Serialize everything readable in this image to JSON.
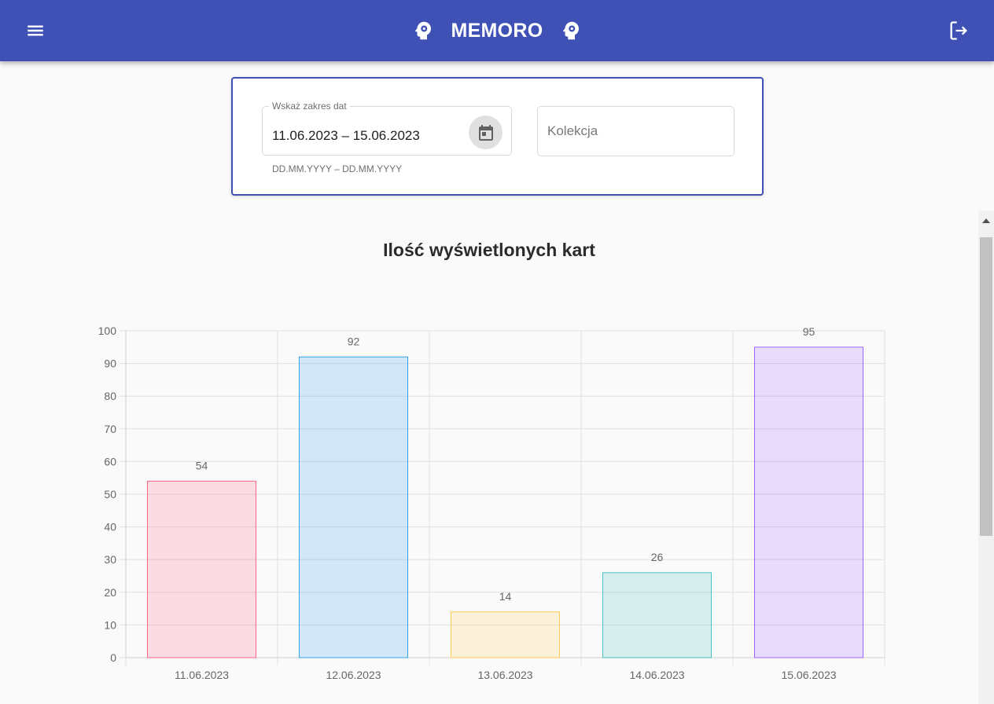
{
  "header": {
    "title": "MEMORO",
    "menu_icon": "hamburger-menu-icon",
    "logout_icon": "logout-icon",
    "brand_icon": "head-gear-icon",
    "bar_color": "#3f51b5"
  },
  "filters": {
    "date_range_label": "Wskaż zakres dat",
    "date_range_value": "11.06.2023 – 15.06.2023",
    "date_range_hint": "DD.MM.YYYY – DD.MM.YYYY",
    "calendar_icon": "calendar-icon",
    "collection_placeholder": "Kolekcja"
  },
  "chart_data": {
    "type": "bar",
    "title": "Ilość wyświetlonych kart",
    "categories": [
      "11.06.2023",
      "12.06.2023",
      "13.06.2023",
      "14.06.2023",
      "15.06.2023"
    ],
    "values": [
      54,
      92,
      14,
      26,
      95
    ],
    "ylim": [
      0,
      100
    ],
    "yticks": [
      0,
      10,
      20,
      30,
      40,
      50,
      60,
      70,
      80,
      90,
      100
    ],
    "grid": true,
    "legend": "none",
    "data_labels": true,
    "bar_colors": [
      "#ff6384",
      "#36a2eb",
      "#ffcd56",
      "#4bc0c0",
      "#9966ff"
    ]
  }
}
